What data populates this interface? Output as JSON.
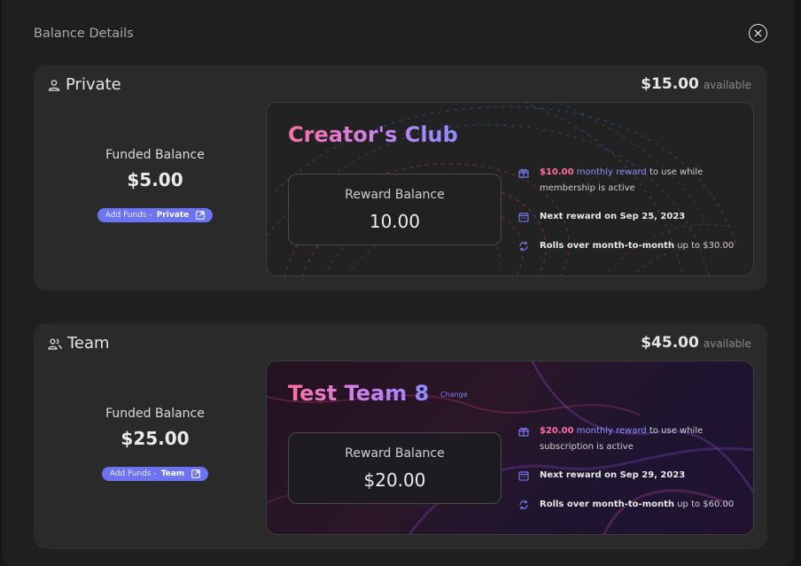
{
  "modal": {
    "title": "Balance Details"
  },
  "private": {
    "title": "Private",
    "available_amount": "$15.00",
    "available_label": "available",
    "funded_title": "Funded Balance",
    "funded_amount": "$5.00",
    "add_funds_label": "Add Funds -",
    "add_funds_target": "Private",
    "promo": {
      "name": "Creator's Club",
      "reward_title": "Reward Balance",
      "reward_amount": "10.00",
      "perk1_amount": "$10.00",
      "perk1_highlight": "monthly reward",
      "perk1_text": "to use while membership is active",
      "perk2_text": "Next reward on Sep 25, 2023",
      "perk3_text": "Rolls over month-to-month",
      "perk3_suffix": "up to $30.00"
    }
  },
  "team": {
    "title": "Team",
    "available_amount": "$45.00",
    "available_label": "available",
    "funded_title": "Funded Balance",
    "funded_amount": "$25.00",
    "add_funds_label": "Add Funds -",
    "add_funds_target": "Team",
    "promo": {
      "name": "Test Team 8",
      "change_label": "Change",
      "reward_title": "Reward Balance",
      "reward_amount": "$20.00",
      "perk1_amount": "$20.00",
      "perk1_highlight": "monthly reward",
      "perk1_text": "to use while subscription is active",
      "perk2_text": "Next reward on Sep 29, 2023",
      "perk3_text": "Rolls over month-to-month",
      "perk3_suffix": "up to $60.00"
    }
  },
  "colors": {
    "accent": "#6d74f3",
    "pink": "#ff6fa3",
    "blue": "#8f92ff",
    "card": "#2a2a2a",
    "modal": "#1f1f1f"
  },
  "icons": [
    "close-icon",
    "person-icon",
    "people-icon",
    "external-link-icon",
    "gift-icon",
    "calendar-icon",
    "refresh-icon"
  ]
}
